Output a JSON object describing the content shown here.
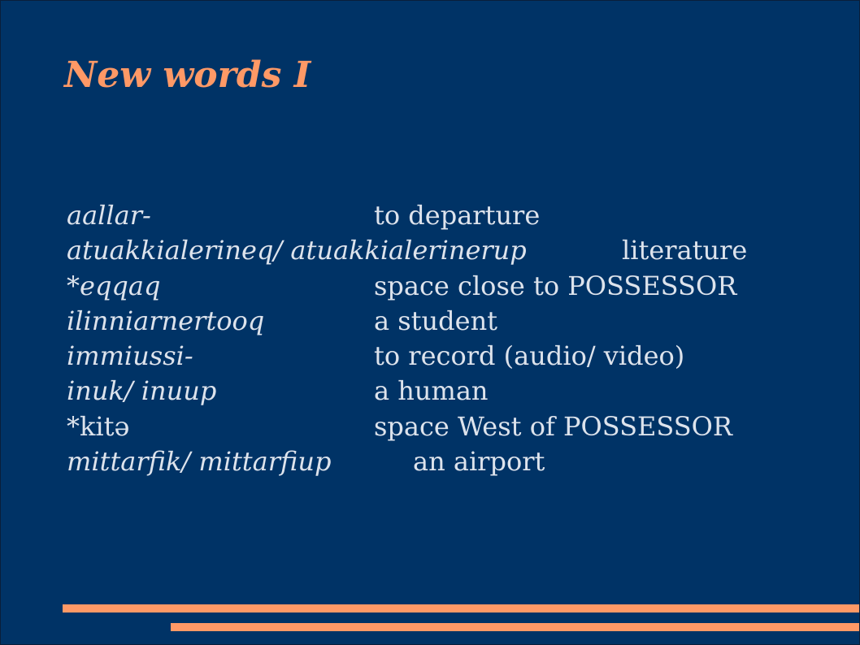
{
  "slide": {
    "title": "New words I",
    "accent_color": "#ff9966",
    "background_color": "#003366",
    "text_color": "#dde3ec",
    "entries": [
      {
        "prefix": "",
        "word": "aallar-",
        "definition": "to departure"
      },
      {
        "prefix": "",
        "word": "atuakkialerineq/ atuakkialerinerup",
        "definition": "literature"
      },
      {
        "prefix": "*",
        "word": "eqqaq",
        "definition": "space close to POSSESSOR"
      },
      {
        "prefix": "",
        "word": "ilinniarnertooq",
        "definition": "a student"
      },
      {
        "prefix": "",
        "word": "immiussi-",
        "definition": "to record (audio/ video)"
      },
      {
        "prefix": "",
        "word": "inuk/ inuup",
        "definition": "a human"
      },
      {
        "prefix": "*kitə",
        "word": "",
        "definition": "space West of POSSESSOR"
      },
      {
        "prefix": "",
        "word": "mittarfik/ mittarfiup",
        "definition": "an airport"
      }
    ]
  }
}
